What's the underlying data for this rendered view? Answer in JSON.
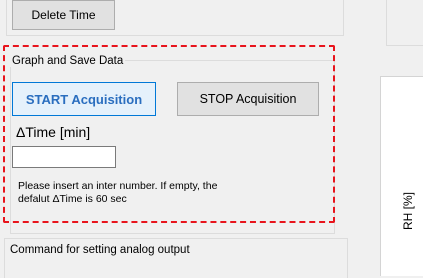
{
  "top_group": {
    "delete_time_label": "Delete Time"
  },
  "graph_group": {
    "title": "Graph and Save Data",
    "start_label": "START Acquisition",
    "stop_label": "STOP Acquisition",
    "delta_time_label": "ΔTime [min]",
    "delta_time_value": "",
    "help_line1": "Please insert an inter number. If empty, the",
    "help_line2": "defalut ΔTime is 60 sec"
  },
  "command_group": {
    "title": "Command for setting analog output"
  },
  "chart_panel": {
    "y_axis_label": "RH [%]"
  },
  "colors": {
    "highlight": "#e8141c",
    "start_text": "#2a6ebf",
    "start_border": "#0078d7"
  }
}
